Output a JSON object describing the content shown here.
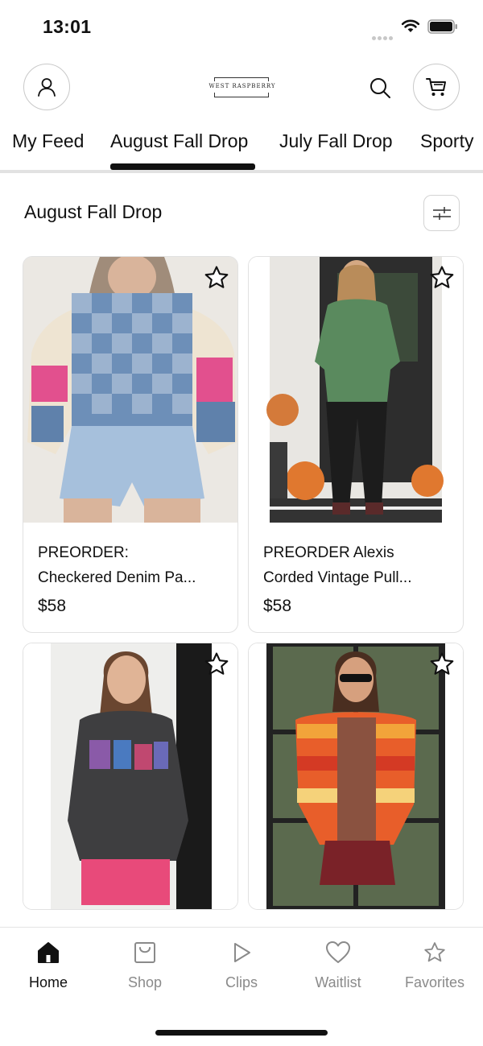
{
  "status_bar": {
    "time": "13:01"
  },
  "header": {
    "logo_text": "WEST RASPBERRY",
    "account_icon": "person-icon",
    "search_icon": "search-icon",
    "cart_icon": "cart-icon"
  },
  "tabs": [
    {
      "label": "My Feed",
      "active": false
    },
    {
      "label": "August Fall Drop",
      "active": true
    },
    {
      "label": "July Fall Drop",
      "active": false
    },
    {
      "label": "Sporty",
      "active": false
    }
  ],
  "section": {
    "title": "August Fall Drop",
    "filter_icon": "sliders-icon"
  },
  "products": [
    {
      "name_line1": "PREORDER:",
      "name_line2": "Checkered Denim Pa...",
      "price": "$58"
    },
    {
      "name_line1": "PREORDER Alexis",
      "name_line2": "Corded Vintage Pull...",
      "price": "$58"
    },
    {
      "name_line1": "",
      "name_line2": "",
      "price": ""
    },
    {
      "name_line1": "",
      "name_line2": "",
      "price": ""
    }
  ],
  "bottom_nav": [
    {
      "label": "Home",
      "icon": "home-icon",
      "active": true
    },
    {
      "label": "Shop",
      "icon": "shopping-bag-icon",
      "active": false
    },
    {
      "label": "Clips",
      "icon": "play-icon",
      "active": false
    },
    {
      "label": "Waitlist",
      "icon": "heart-icon",
      "active": false
    },
    {
      "label": "Favorites",
      "icon": "star-icon",
      "active": false
    }
  ],
  "colors": {
    "accent": "#111111",
    "muted": "#8a8a8a",
    "divider": "#e2e2e2"
  }
}
